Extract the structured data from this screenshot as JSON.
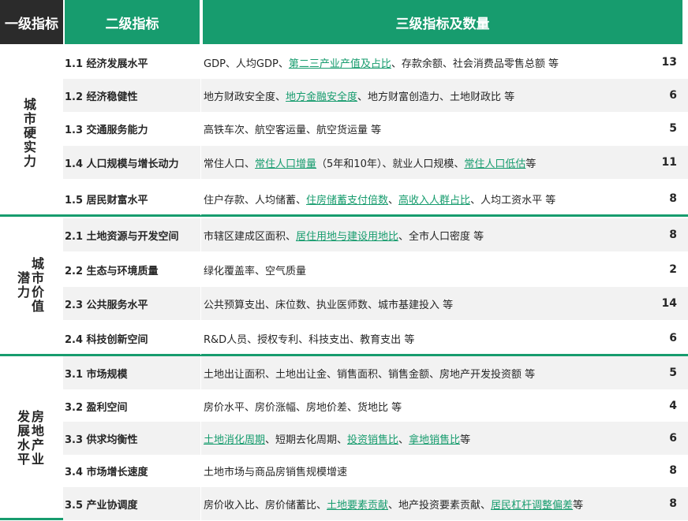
{
  "header": {
    "col1": "一级指标",
    "col2": "二级指标",
    "col3": "三级指标及数量"
  },
  "groups": [
    {
      "label_lines": [
        "城",
        "市",
        "硬",
        "实",
        "力"
      ]
    },
    {
      "label_lines_a": [
        "城",
        "市",
        "价",
        "值"
      ],
      "label_lines_b": [
        "潜",
        "力"
      ]
    },
    {
      "label_lines_a": [
        "房",
        "地",
        "产",
        "业"
      ],
      "label_lines_b": [
        "发",
        "展",
        "水",
        "平"
      ]
    }
  ],
  "rows": [
    {
      "name": "1.1 经济发展水平",
      "count": "13",
      "segments": [
        {
          "t": "GDP、人均GDP、"
        },
        {
          "t": "第二三产业产值及占比",
          "hl": true
        },
        {
          "t": "、存款余额、社会消费品零售总额 等"
        }
      ]
    },
    {
      "name": "1.2 经济稳健性",
      "count": "6",
      "segments": [
        {
          "t": "地方财政安全度、"
        },
        {
          "t": "地方金融安全度",
          "hl": true
        },
        {
          "t": "、地方财富创造力、土地财政比 等"
        }
      ]
    },
    {
      "name": "1.3 交通服务能力",
      "count": "5",
      "segments": [
        {
          "t": "高铁车次、航空客运量、航空货运量 等"
        }
      ]
    },
    {
      "name": "1.4 人口规模与增长动力",
      "count": "11",
      "segments": [
        {
          "t": "常住人口、"
        },
        {
          "t": "常住人口增量",
          "hl": true
        },
        {
          "t": "（5年和10年）、就业人口规模、"
        },
        {
          "t": "常住人口低估",
          "hl": true
        },
        {
          "t": " 等"
        }
      ]
    },
    {
      "name": "1.5 居民财富水平",
      "count": "8",
      "segments": [
        {
          "t": "住户存款、人均储蓄、"
        },
        {
          "t": "住房储蓄支付倍数",
          "hl": true
        },
        {
          "t": "、"
        },
        {
          "t": "高收入人群占比",
          "hl": true
        },
        {
          "t": "、人均工资水平 等"
        }
      ]
    },
    {
      "name": "2.1 土地资源与开发空间",
      "count": "8",
      "segments": [
        {
          "t": "市辖区建成区面积、"
        },
        {
          "t": "居住用地与建设用地比",
          "hl": true
        },
        {
          "t": "、全市人口密度 等"
        }
      ]
    },
    {
      "name": "2.2 生态与环境质量",
      "count": "2",
      "segments": [
        {
          "t": "绿化覆盖率、空气质量"
        }
      ]
    },
    {
      "name": "2.3 公共服务水平",
      "count": "14",
      "segments": [
        {
          "t": "公共预算支出、床位数、执业医师数、城市基建投入 等"
        }
      ]
    },
    {
      "name": "2.4 科技创新空间",
      "count": "6",
      "segments": [
        {
          "t": "R&D人员、授权专利、科技支出、教育支出 等"
        }
      ]
    },
    {
      "name": "3.1 市场规模",
      "count": "5",
      "segments": [
        {
          "t": "土地出让面积、土地出让金、销售面积、销售金额、房地产开发投资额 等"
        }
      ]
    },
    {
      "name": "3.2 盈利空间",
      "count": "4",
      "segments": [
        {
          "t": "房价水平、房价涨幅、房地价差、货地比 等"
        }
      ]
    },
    {
      "name": "3.3 供求均衡性",
      "count": "6",
      "segments": [
        {
          "t": "土地消化周期",
          "hl": true
        },
        {
          "t": "、短期去化周期、"
        },
        {
          "t": "投资销售比",
          "hl": true
        },
        {
          "t": "、"
        },
        {
          "t": "拿地销售比",
          "hl": true
        },
        {
          "t": " 等"
        }
      ]
    },
    {
      "name": "3.4 市场增长速度",
      "count": "8",
      "segments": [
        {
          "t": "土地市场与商品房销售规模增速"
        }
      ]
    },
    {
      "name": "3.5 产业协调度",
      "count": "8",
      "segments": [
        {
          "t": "房价收入比、房价储蓄比、"
        },
        {
          "t": "土地要素贡献",
          "hl": true
        },
        {
          "t": "、地产投资要素贡献、"
        },
        {
          "t": "居民杠杆调整偏差",
          "hl": true
        },
        {
          "t": " 等"
        }
      ]
    }
  ]
}
